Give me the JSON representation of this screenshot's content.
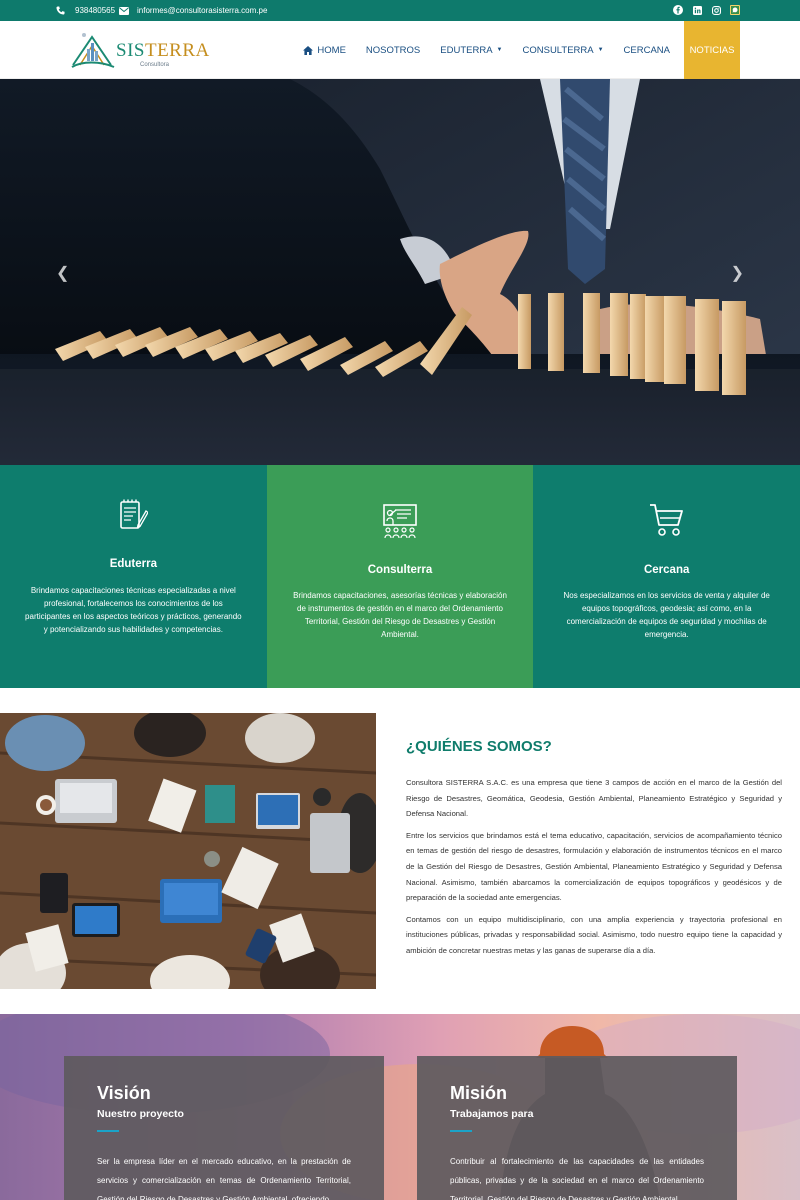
{
  "topbar": {
    "phone": "938480565",
    "email": "informes@consultorasisterra.com.pe",
    "social": [
      "facebook-icon",
      "linkedin-icon",
      "instagram-icon",
      "whatsapp-icon"
    ]
  },
  "logo": {
    "brand_a": "SIS",
    "brand_b": "TERRA",
    "sub": "Consultora"
  },
  "nav": {
    "home": "HOME",
    "nosotros": "NOSOTROS",
    "eduterra": "EDUTERRA",
    "consulterra": "CONSULTERRA",
    "cercana": "CERCANA",
    "noticias": "NOTICIAS"
  },
  "services": [
    {
      "title": "Eduterra",
      "text": "Brindamos capacitaciones técnicas especializadas a nivel profesional, fortalecemos los conocimientos de los participantes en los aspectos teóricos y prácticos, generando y potencializando sus habilidades y competencias."
    },
    {
      "title": "Consulterra",
      "text": "Brindamos capacitaciones, asesorías técnicas y elaboración de instrumentos de gestión en el marco del Ordenamiento Territorial, Gestión del Riesgo de Desastres y Gestión Ambiental."
    },
    {
      "title": "Cercana",
      "text": "Nos especializamos en los servicios de venta y alquiler de equipos topográficos, geodesia; así como, en la comercialización de equipos de seguridad y mochilas de emergencia."
    }
  ],
  "about": {
    "title": "¿QUIÉNES SOMOS?",
    "p1": "Consultora SISTERRA S.A.C. es una empresa que tiene 3 campos de acción en el marco de la Gestión del Riesgo de Desastres, Geomática, Geodesia, Gestión Ambiental, Planeamiento Estratégico y Seguridad y Defensa Nacional.",
    "p2": "Entre los servicios que brindamos está el tema educativo, capacitación, servicios de acompañamiento técnico en temas de gestión del riesgo de desastres, formulación y elaboración de instrumentos técnicos en el marco de la Gestión del Riesgo de Desastres, Gestión Ambiental, Planeamiento Estratégico y Seguridad y Defensa Nacional. Asimismo, también abarcamos la comercialización de equipos topográficos y geodésicos y de preparación de la sociedad ante emergencias.",
    "p3": "Contamos con un equipo multidisciplinario, con una amplia experiencia y trayectoria profesional en instituciones públicas, privadas y responsabilidad social. Asimismo, todo nuestro equipo tiene la capacidad y ambición de concretar nuestras metas y las ganas de superarse día a día."
  },
  "vision": {
    "title": "Visión",
    "subtitle": "Nuestro proyecto",
    "text": "Ser la empresa líder en el mercado educativo, en la prestación de servicios y comercialización en temas de Ordenamiento Territorial, Gestión del Riesgo de Desastres y Gestión Ambiental, ofreciendo"
  },
  "mission": {
    "title": "Misión",
    "subtitle": "Trabajamos para",
    "text": "Contribuir al fortalecimiento de las capacidades de las entidades públicas, privadas y de la sociedad en el marco del Ordenamiento Territorial, Gestión del Riesgo de Desastres y Gestión Ambiental,"
  },
  "colors": {
    "brand_green": "#0e7a6c",
    "accent_green": "#3b9d57",
    "accent_yellow": "#e8b530",
    "nav_blue": "#1a4f82"
  }
}
